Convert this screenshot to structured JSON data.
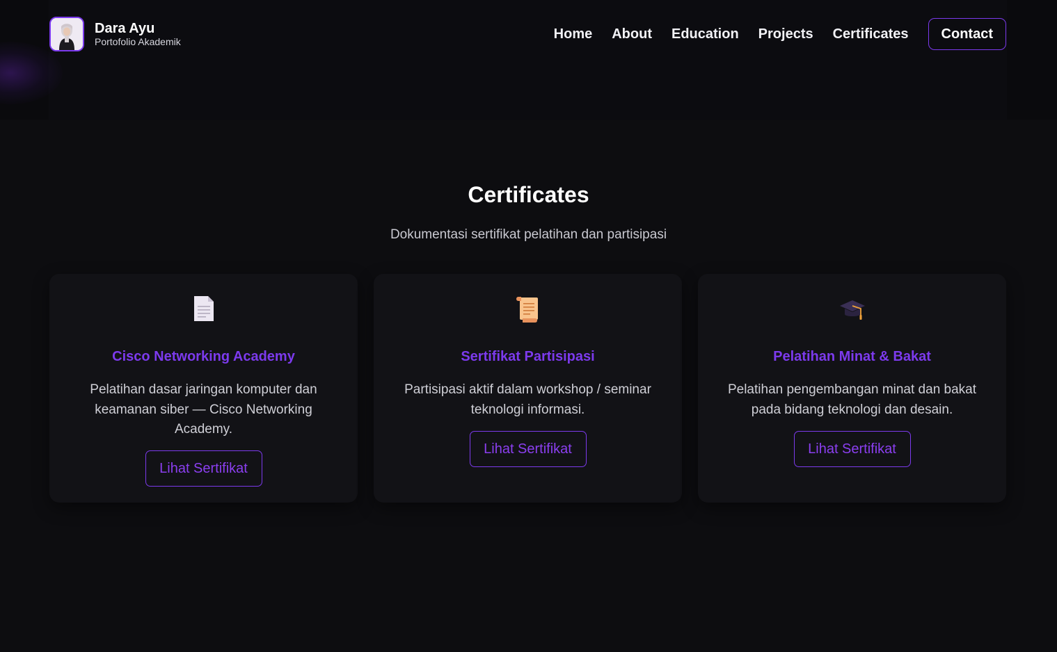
{
  "header": {
    "brand_name": "Dara Ayu",
    "brand_subtitle": "Portofolio Akademik",
    "nav": [
      "Home",
      "About",
      "Education",
      "Projects",
      "Certificates"
    ],
    "contact_label": "Contact"
  },
  "section": {
    "title": "Certificates",
    "subtitle": "Dokumentasi sertifikat pelatihan dan partisipasi"
  },
  "cards": [
    {
      "icon": "document-icon",
      "title": "Cisco Networking Academy",
      "description": "Pelatihan dasar jaringan komputer dan keamanan siber — Cisco Networking Academy.",
      "button": "Lihat Sertifikat"
    },
    {
      "icon": "scroll-icon",
      "title": "Sertifikat Partisipasi",
      "description": "Partisipasi aktif dalam workshop / seminar teknologi informasi.",
      "button": "Lihat Sertifikat"
    },
    {
      "icon": "graduation-cap-icon",
      "title": "Pelatihan Minat & Bakat",
      "description": "Pelatihan pengembangan minat dan bakat pada bidang teknologi dan desain.",
      "button": "Lihat Sertifikat"
    }
  ],
  "colors": {
    "accent": "#7c3aed",
    "background": "#0d0d10",
    "card": "#121216"
  }
}
